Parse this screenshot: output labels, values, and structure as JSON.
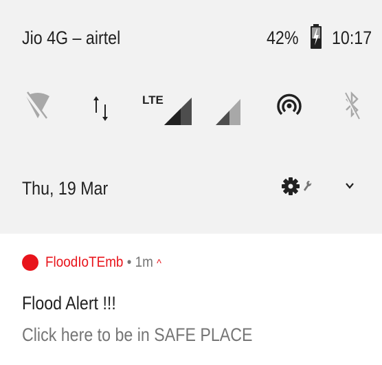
{
  "status_bar": {
    "carrier": "Jio 4G – airtel",
    "battery_percent": "42%",
    "time": "10:17"
  },
  "quick_settings": {
    "lte_label": "LTE",
    "tiles": [
      {
        "icon": "wifi-off-icon"
      },
      {
        "icon": "mobile-data-icon"
      },
      {
        "icon": "lte-signal-icon"
      },
      {
        "icon": "signal-icon"
      },
      {
        "icon": "hotspot-icon"
      },
      {
        "icon": "bluetooth-off-icon"
      }
    ]
  },
  "date_row": {
    "date": "Thu, 19 Mar"
  },
  "notification": {
    "app_name": "FloodIoTEmb",
    "separator": " • ",
    "age": "1m",
    "caret": "^",
    "title": "Flood Alert !!!",
    "text": "Click here to be in SAFE PLACE"
  },
  "colors": {
    "accent": "#e8141b",
    "shade_bg": "#f2f2f2",
    "primary_text": "#212121",
    "secondary_text": "#757575"
  }
}
